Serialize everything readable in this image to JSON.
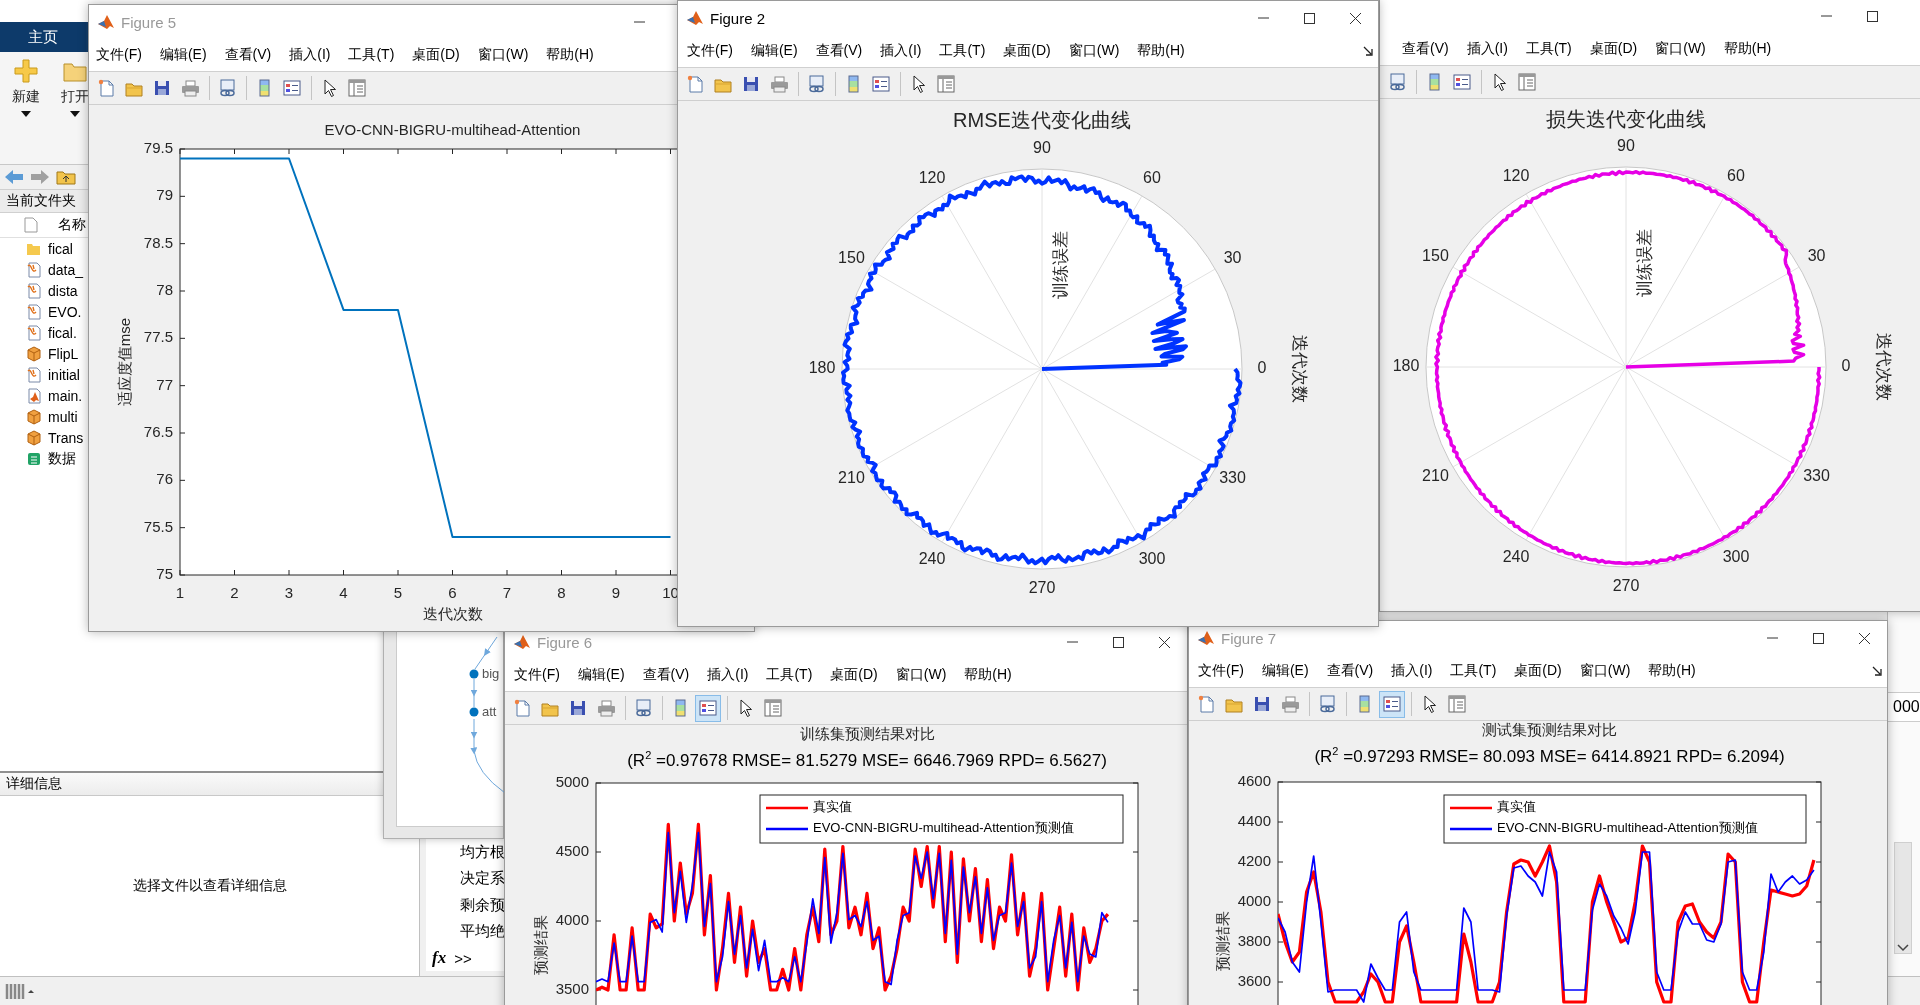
{
  "main_window": {
    "tab": "主页",
    "tools": [
      {
        "label": "新建",
        "kind": "new"
      },
      {
        "label": "打开",
        "kind": "open"
      }
    ],
    "current_folder": {
      "title": "当前文件夹",
      "column": "名称",
      "files": [
        {
          "name": "fical",
          "kind": "folder"
        },
        {
          "name": "data_",
          "kind": "function"
        },
        {
          "name": "dista",
          "kind": "function"
        },
        {
          "name": "EVO.",
          "kind": "function"
        },
        {
          "name": "fical.",
          "kind": "function"
        },
        {
          "name": "FlipL",
          "kind": "class"
        },
        {
          "name": "initial",
          "kind": "function"
        },
        {
          "name": "main.",
          "kind": "script"
        },
        {
          "name": "multi",
          "kind": "class"
        },
        {
          "name": "Trans",
          "kind": "class"
        },
        {
          "name": "数据",
          "kind": "spreadsheet"
        }
      ]
    },
    "details": {
      "title": "详细信息",
      "message": "选择文件以查看详细信息"
    },
    "command_window": {
      "lines": [
        "均方根",
        "决定系",
        "剩余预",
        "平均绝"
      ],
      "function_label": "fx",
      "prompt": ">>"
    },
    "workspace": {
      "value": "000"
    }
  },
  "network_window": {
    "nodes": [
      "big",
      "att"
    ]
  },
  "figures": [
    {
      "title": "Figure 5",
      "active": false,
      "window_buttons": {
        "minimize": true,
        "maximize": false,
        "close": false
      },
      "menu": [
        "文件(F)",
        "编辑(E)",
        "查看(V)",
        "插入(I)",
        "工具(T)",
        "桌面(D)",
        "窗口(W)",
        "帮助(H)"
      ],
      "dock_arrow": false,
      "toolbar": [
        {
          "kind": "new"
        },
        {
          "kind": "open"
        },
        {
          "kind": "save"
        },
        {
          "kind": "print"
        },
        {
          "kind": "separator"
        },
        {
          "kind": "linked"
        },
        {
          "kind": "separator"
        },
        {
          "kind": "colorbar"
        },
        {
          "kind": "legend"
        },
        {
          "kind": "separator"
        },
        {
          "kind": "pointer"
        },
        {
          "kind": "panel"
        }
      ],
      "legend_pressed": false,
      "plot": {
        "kind": "cartesian",
        "chart_data": {
          "type": "line",
          "title": "EVO-CNN-BIGRU-multihead-Attention",
          "xlabel": "迭代次数",
          "ylabel": "适应度值mse",
          "x": [
            1,
            2,
            3,
            4,
            5,
            6,
            7,
            8,
            9,
            10
          ],
          "series": [
            {
              "color": "#0072bd",
              "values": [
                79.4,
                79.4,
                79.4,
                77.8,
                77.8,
                75.4,
                75.4,
                75.4,
                75.4,
                75.4
              ]
            }
          ],
          "xlim": [
            1,
            11
          ],
          "ylim": [
            75,
            79.5
          ],
          "xticks": [
            1,
            2,
            3,
            4,
            5,
            6,
            7,
            8,
            9,
            10
          ],
          "yticks": [
            75,
            75.5,
            76,
            76.5,
            77,
            77.5,
            78,
            78.5,
            79,
            79.5
          ]
        }
      }
    },
    {
      "title": "Figure 2",
      "active": true,
      "window_buttons": {
        "minimize": true,
        "maximize": true,
        "close": true
      },
      "menu": [
        "文件(F)",
        "编辑(E)",
        "查看(V)",
        "插入(I)",
        "工具(T)",
        "桌面(D)",
        "窗口(W)",
        "帮助(H)"
      ],
      "dock_arrow": true,
      "toolbar": [
        {
          "kind": "new"
        },
        {
          "kind": "open"
        },
        {
          "kind": "save"
        },
        {
          "kind": "print"
        },
        {
          "kind": "separator"
        },
        {
          "kind": "linked"
        },
        {
          "kind": "separator"
        },
        {
          "kind": "colorbar"
        },
        {
          "kind": "legend"
        },
        {
          "kind": "separator"
        },
        {
          "kind": "pointer"
        },
        {
          "kind": "panel"
        }
      ],
      "legend_pressed": false,
      "plot": {
        "kind": "polar",
        "title": "RMSE迭代变化曲线",
        "color": "#0033ff",
        "angle_labels": [
          "0",
          "30",
          "60",
          "90",
          "120",
          "150",
          "180",
          "210",
          "240",
          "270",
          "300",
          "330"
        ],
        "radial_label": "训练误差",
        "angle_axis_label": "迭代次数"
      }
    },
    {
      "window_buttons": {
        "minimize": true,
        "maximize": true,
        "close": false
      },
      "menu": [
        "查看(V)",
        "插入(I)",
        "工具(T)",
        "桌面(D)",
        "窗口(W)",
        "帮助(H)"
      ],
      "dock_arrow": false,
      "toolbar": [
        {
          "kind": "linked"
        },
        {
          "kind": "separator"
        },
        {
          "kind": "colorbar"
        },
        {
          "kind": "legend"
        },
        {
          "kind": "separator"
        },
        {
          "kind": "pointer"
        },
        {
          "kind": "panel"
        }
      ],
      "legend_pressed": false,
      "plot": {
        "kind": "polar",
        "title": "损失迭代变化曲线",
        "color": "#e600e6",
        "angle_labels": [
          "0",
          "30",
          "60",
          "90",
          "120",
          "150",
          "180",
          "210",
          "240",
          "270",
          "300",
          "330"
        ],
        "radial_label": "训练误差",
        "angle_axis_label": "迭代次数"
      }
    },
    {
      "title": "Figure 6",
      "active": false,
      "window_buttons": {
        "minimize": true,
        "maximize": true,
        "close": true
      },
      "menu": [
        "文件(F)",
        "编辑(E)",
        "查看(V)",
        "插入(I)",
        "工具(T)",
        "桌面(D)",
        "窗口(W)",
        "帮助(H)"
      ],
      "dock_arrow": false,
      "toolbar": [
        {
          "kind": "new"
        },
        {
          "kind": "open"
        },
        {
          "kind": "save"
        },
        {
          "kind": "print"
        },
        {
          "kind": "separator"
        },
        {
          "kind": "linked"
        },
        {
          "kind": "separator"
        },
        {
          "kind": "colorbar"
        },
        {
          "kind": "legend"
        },
        {
          "kind": "separator"
        },
        {
          "kind": "pointer"
        },
        {
          "kind": "panel"
        }
      ],
      "legend_pressed": true,
      "plot": {
        "kind": "cartesian",
        "subtitle": "(R$^{2}$ =0.97678 RMSE= 81.5279 MSE= 6646.7969 RPD= 6.5627)",
        "chart_data": {
          "type": "line",
          "title": "训练集预测结果对比",
          "ylabel": "预测结果",
          "categories": [
            null,
            null,
            null,
            null,
            null,
            null,
            null,
            null,
            null,
            null,
            null,
            null,
            null,
            null,
            null,
            null,
            null,
            null,
            null,
            null,
            null,
            null,
            null,
            null,
            null,
            null,
            null,
            null,
            null,
            null,
            null,
            null,
            null,
            null,
            null,
            null,
            null,
            null,
            null,
            null,
            null,
            null,
            null,
            null,
            null,
            null,
            null,
            null,
            null,
            null,
            null,
            null,
            null,
            null,
            null,
            null,
            null,
            null,
            null,
            null,
            null,
            null,
            null,
            null,
            null,
            null,
            null,
            null,
            null,
            null,
            null,
            null,
            null,
            null,
            null,
            null,
            null,
            null,
            null,
            null,
            null,
            null,
            null,
            null,
            null,
            null
          ],
          "series": [
            {
              "name": "真实值",
              "color": "#ff0000",
              "values": [
                3500,
                3520,
                3500,
                3900,
                3500,
                3500,
                3950,
                3500,
                3500,
                4050,
                3950,
                3980,
                4700,
                4000,
                4420,
                4050,
                4200,
                4700,
                3900,
                4330,
                3500,
                3800,
                4200,
                3700,
                4100,
                3600,
                4000,
                3700,
                3800,
                3500,
                3500,
                3650,
                3500,
                3800,
                3500,
                3900,
                4100,
                3850,
                4520,
                3900,
                4000,
                4540,
                3950,
                4100,
                3900,
                4200,
                3800,
                3950,
                3500,
                3600,
                3800,
                4100,
                4000,
                4520,
                4250,
                4540,
                4100,
                4540,
                3850,
                4500,
                3700,
                4450,
                4000,
                4380,
                3850,
                4300,
                3800,
                4100,
                4000,
                4480,
                3900,
                4200,
                3600,
                3800,
                4200,
                3500,
                3800,
                4100,
                3600,
                4050,
                3500,
                3950,
                3700,
                3800,
                4000,
                4050
              ]
            },
            {
              "name": "EVO-CNN-BIGRU-multihead-Attention预测值",
              "color": "#0000ff",
              "values": [
                3560,
                3580,
                3560,
                3840,
                3560,
                3560,
                3890,
                3560,
                3560,
                3990,
                4010,
                3920,
                4640,
                4060,
                4360,
                3990,
                4260,
                4640,
                3960,
                4270,
                3560,
                3740,
                4140,
                3760,
                4040,
                3660,
                3940,
                3640,
                3860,
                3560,
                3560,
                3590,
                3560,
                3740,
                3560,
                3840,
                4160,
                3910,
                4460,
                3840,
                4060,
                4490,
                4010,
                4040,
                3960,
                4140,
                3860,
                3890,
                3560,
                3540,
                3860,
                4040,
                4060,
                4470,
                4310,
                4500,
                4160,
                4490,
                3910,
                4440,
                3760,
                4390,
                4060,
                4320,
                3910,
                4240,
                3860,
                4040,
                4060,
                4420,
                3960,
                4140,
                3660,
                3740,
                4140,
                3560,
                3860,
                4040,
                3660,
                3990,
                3560,
                3890,
                3760,
                3740,
                4060,
                3990
              ]
            }
          ],
          "legend": "upper right",
          "ylim": [
            3000,
            5000
          ],
          "yticks": [
            3500,
            4000,
            4500,
            5000
          ]
        }
      }
    },
    {
      "title": "Figure 7",
      "active": false,
      "window_buttons": {
        "minimize": true,
        "maximize": true,
        "close": true
      },
      "menu": [
        "文件(F)",
        "编辑(E)",
        "查看(V)",
        "插入(I)",
        "工具(T)",
        "桌面(D)",
        "窗口(W)",
        "帮助(H)"
      ],
      "dock_arrow": true,
      "toolbar": [
        {
          "kind": "new"
        },
        {
          "kind": "open"
        },
        {
          "kind": "save"
        },
        {
          "kind": "print"
        },
        {
          "kind": "separator"
        },
        {
          "kind": "linked"
        },
        {
          "kind": "separator"
        },
        {
          "kind": "colorbar"
        },
        {
          "kind": "legend"
        },
        {
          "kind": "separator"
        },
        {
          "kind": "pointer"
        },
        {
          "kind": "panel"
        }
      ],
      "legend_pressed": true,
      "plot": {
        "kind": "cartesian",
        "subtitle": "(R$^{2}$ =0.97293 RMSE= 80.093 MSE= 6414.8921 RPD= 6.2094)",
        "chart_data": {
          "type": "line",
          "title": "测试集预测结果对比",
          "ylabel": "预测结果",
          "categories": [
            null,
            null,
            null,
            null,
            null,
            null,
            null,
            null,
            null,
            null,
            null,
            null,
            null,
            null,
            null,
            null,
            null,
            null,
            null,
            null,
            null,
            null,
            null,
            null,
            null,
            null,
            null,
            null,
            null,
            null,
            null,
            null,
            null,
            null,
            null,
            null,
            null,
            null,
            null,
            null,
            null,
            null,
            null,
            null,
            null,
            null,
            null,
            null,
            null,
            null,
            null,
            null,
            null,
            null,
            null,
            null,
            null,
            null,
            null,
            null,
            null,
            null,
            null,
            null,
            null,
            null,
            null,
            null,
            null,
            null,
            null,
            null,
            null,
            null,
            null,
            null
          ],
          "series": [
            {
              "name": "真实值",
              "color": "#ff0000",
              "values": [
                3940,
                3800,
                3700,
                3750,
                4050,
                4150,
                3950,
                3600,
                3500,
                3500,
                3500,
                3500,
                3550,
                3640,
                3600,
                3500,
                3500,
                3800,
                3880,
                3700,
                3500,
                3500,
                3500,
                3500,
                3500,
                3500,
                3840,
                3700,
                3500,
                3500,
                3500,
                3600,
                3950,
                4190,
                4210,
                4200,
                4130,
                4200,
                4280,
                4100,
                3500,
                3500,
                3500,
                3500,
                4000,
                4130,
                4000,
                3900,
                3800,
                3820,
                4000,
                4280,
                4200,
                3600,
                3500,
                3500,
                3900,
                3980,
                3990,
                3900,
                3850,
                3820,
                3900,
                4240,
                4200,
                3600,
                3500,
                3500,
                3800,
                4060,
                4050,
                4040,
                4030,
                4040,
                4080,
                4210
              ]
            },
            {
              "name": "EVO-CNN-BIGRU-multihead-Attention预测值",
              "color": "#0000ff",
              "values": [
                3920,
                3850,
                3700,
                3650,
                4000,
                4230,
                3900,
                3550,
                3560,
                3560,
                3560,
                3560,
                3500,
                3690,
                3620,
                3560,
                3560,
                3900,
                3950,
                3650,
                3560,
                3560,
                3560,
                3560,
                3560,
                3560,
                3970,
                3900,
                3560,
                3560,
                3560,
                3550,
                3930,
                4170,
                4180,
                4130,
                4100,
                4030,
                4250,
                4150,
                3560,
                3560,
                3560,
                3560,
                3960,
                4090,
                4030,
                3930,
                3870,
                3790,
                3950,
                4250,
                4250,
                3650,
                3560,
                3560,
                3850,
                3950,
                3890,
                3890,
                3810,
                3800,
                3890,
                4200,
                4210,
                3650,
                3560,
                3560,
                3750,
                4140,
                4050,
                4100,
                4130,
                4090,
                4110,
                4160
              ]
            }
          ],
          "legend": "upper right",
          "ylim": [
            3400,
            4600
          ],
          "yticks": [
            3600,
            3800,
            4000,
            4200,
            4400,
            4600
          ]
        }
      }
    }
  ]
}
